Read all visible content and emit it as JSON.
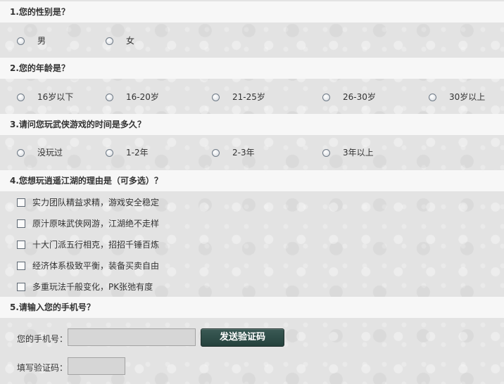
{
  "questions": [
    {
      "title": "1.您的性别是？",
      "options": [
        "男",
        "女"
      ]
    },
    {
      "title": "2.您的年龄是？",
      "options": [
        "16岁以下",
        "16-20岁",
        "21-25岁",
        "26-30岁",
        "30岁以上"
      ]
    },
    {
      "title": "3.请问您玩武侠游戏的时间是多久？",
      "options": [
        "没玩过",
        "1-2年",
        "2-3年",
        "3年以上"
      ]
    },
    {
      "title": "4.您想玩逍遥江湖的理由是（可多选）？",
      "options": [
        "实力团队精益求精，游戏安全稳定",
        "原汁原味武侠网游，江湖绝不走样",
        "十大门派五行相克，招招千锤百炼",
        "经济体系极致平衡，装备买卖自由",
        "多重玩法千般变化，PK张弛有度"
      ]
    },
    {
      "title": "5.请输入您的手机号？",
      "phone_label": "您的手机号：",
      "phone_value": "",
      "send_button": "发送验证码",
      "code_label": "填写验证码：",
      "code_value": ""
    }
  ],
  "colors": {
    "question_bar": "#f7f7f7",
    "page_background": "#e3e3e3",
    "button_background": "#2e4c47",
    "input_background": "#d6d6d6"
  }
}
